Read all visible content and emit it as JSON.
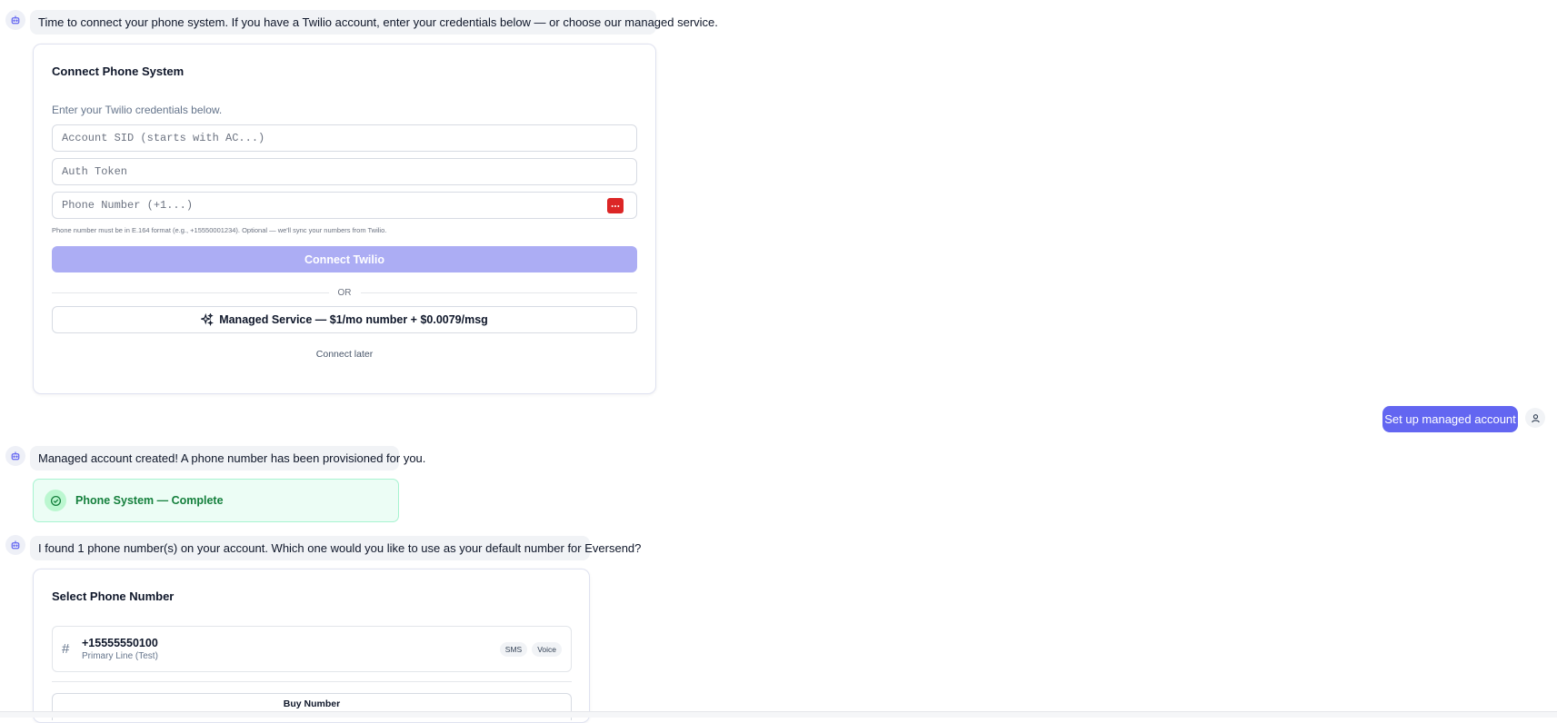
{
  "messages": {
    "intro": "Time to connect your phone system. If you have a Twilio account, enter your credentials below — or choose our managed service.",
    "managed_created": "Managed account created! A phone number has been provisioned for you.",
    "found_numbers": "I found 1 phone number(s) on your account. Which one would you like to use as your default number for Eversend?"
  },
  "connect_card": {
    "title": "Connect Phone System",
    "subtitle": "Enter your Twilio credentials below.",
    "account_sid_placeholder": "Account SID (starts with AC...)",
    "auth_token_placeholder": "Auth Token",
    "phone_placeholder": "Phone Number (+1...)",
    "hint": "Phone number must be in E.164 format (e.g., +15550001234). Optional — we'll sync your numbers from Twilio.",
    "connect_button": "Connect Twilio",
    "or_label": "OR",
    "managed_button": "Managed Service — $1/mo number + $0.0079/msg",
    "connect_later": "Connect later"
  },
  "user_reply": "Set up managed account",
  "status_card": {
    "label": "Phone System — Complete"
  },
  "select_card": {
    "title": "Select Phone Number",
    "numbers": [
      {
        "number": "+15555550100",
        "label": "Primary Line (Test)",
        "tags": [
          "SMS",
          "Voice"
        ]
      }
    ],
    "buy_button": "Buy Number"
  },
  "colors": {
    "accent": "#6366f1",
    "accent_disabled": "#acadf4",
    "success": "#15803d",
    "password_manager_icon": "#dc2626"
  },
  "icons": {
    "bot": "bot-icon",
    "user": "user-icon",
    "sparkles": "sparkles-icon",
    "check": "check-circle-icon",
    "hash": "hash-icon",
    "password_manager": "password-manager-icon"
  }
}
